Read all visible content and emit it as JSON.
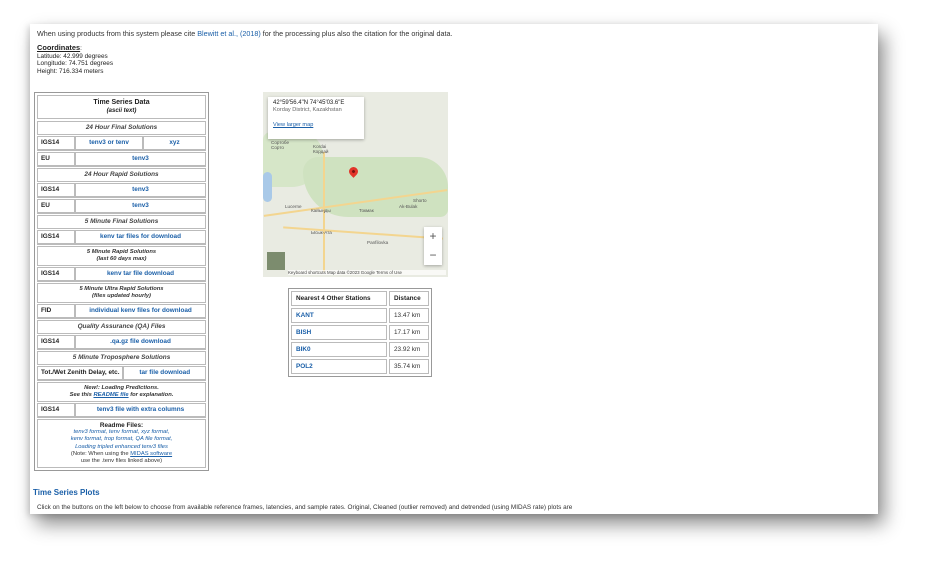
{
  "citation": {
    "pre": "When using products from this system please cite",
    "link": "Blewitt et al., (2018)",
    "post": "for the processing plus also the citation for the original data."
  },
  "coordinates": {
    "heading": "Coordinates",
    "latitude": "Latitude: 42.999 degrees",
    "longitude": "Longitude: 74.751 degrees",
    "height": "Height: 716.334 meters"
  },
  "timeseries": {
    "title": "Time Series Data",
    "subtitle": "(ascii text)",
    "sec_24final": "24 Hour Final Solutions",
    "r1_label": "IGS14",
    "r1_link": "tenv3 or tenv",
    "r1_link2": "xyz",
    "r2_label": "EU",
    "r2_link": "tenv3",
    "sec_24rapid": "24 Hour Rapid Solutions",
    "r3_label": "IGS14",
    "r3_link": "tenv3",
    "r4_label": "EU",
    "r4_link": "tenv3",
    "sec_5final": "5 Minute Final Solutions",
    "r5_label": "IGS14",
    "r5_link": "kenv tar files for download",
    "sec_5rapid": "5 Minute Rapid Solutions",
    "sec_5rapid2": "(last 60 days max)",
    "r6_label": "IGS14",
    "r6_link": "kenv tar file download",
    "sec_5ultra": "5 Minute Ultra Rapid Solutions",
    "sec_5ultra2": "(files updated hourly)",
    "r7_label": "FID",
    "r7_link": "individual kenv files for download",
    "sec_qa": "Quality Assurance (QA) Files",
    "r8_label": "IGS14",
    "r8_link": ".qa.gz file download",
    "sec_trop": "5 Minute Troposphere Solutions",
    "r9_label": "Tot./Wet Zenith Delay, etc.",
    "r9_link": "tar file download",
    "note1": "New!: Loading Predictions.",
    "note2_pre": "See this",
    "note2_link": "README file",
    "note2_post": "for explanation.",
    "r10_label": "IGS14",
    "r10_link": "tenv3 file with extra columns",
    "readme_title": "Readme Files:",
    "readme_l1": "tenv3 format, tenv format, xyz format,",
    "readme_l2": "kenv format, trop format, QA file format,",
    "readme_l3": "Loading tripled enhanced tenv3 files",
    "readme_n1_pre": "(Note: When using the",
    "readme_n1_link": "MIDAS software",
    "readme_n2": "use the .tenv files linked above)"
  },
  "map": {
    "coord": "42°59'56.4\"N 74°45'03.6\"E",
    "place": "Korday District, Kazakhstan",
    "larger": "View larger map",
    "zoom_in": "+",
    "zoom_out": "−",
    "footer": "Keyboard shortcuts   Map data ©2023 Google   Terms of Use",
    "labels": [
      "Кордай",
      "Kordai",
      "Сортобе",
      "Сорто",
      "Кантт",
      "Кант",
      "Lucerne",
      "Кайыңды",
      "Токмак",
      "Ak-Bulak",
      "Ысык-Ата",
      "Дзервенок",
      "Panfilovka",
      "Shorto"
    ]
  },
  "nearest": {
    "h_station": "Nearest 4 Other Stations",
    "h_distance": "Distance",
    "rows": [
      {
        "station": "KANT",
        "distance": "13.47 km"
      },
      {
        "station": "BISH",
        "distance": "17.17 km"
      },
      {
        "station": "BIK0",
        "distance": "23.92 km"
      },
      {
        "station": "POL2",
        "distance": "35.74 km"
      }
    ]
  },
  "plots": {
    "title": "Time Series Plots",
    "text": "Click on the buttons on the left below to choose from available reference frames, latencies, and sample rates. Original, Cleaned (outlier removed) and detrended (using MIDAS rate) plots are"
  },
  "colors": {
    "link": "#1a5fa8",
    "pin": "#e2352a"
  }
}
